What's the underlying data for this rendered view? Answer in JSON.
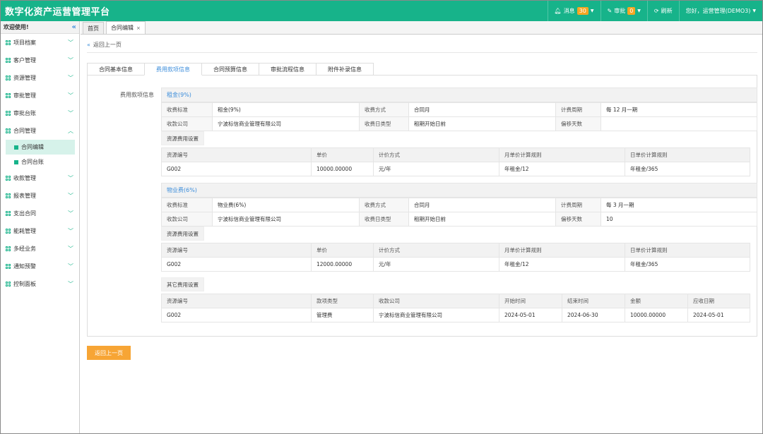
{
  "app": {
    "title": "数字化资产运营管理平台"
  },
  "topbar": {
    "messages_label": "消息",
    "messages_count": "30",
    "approval_label": "审批",
    "approval_count": "0",
    "refresh_label": "刷新",
    "user_label": "您好，运营管理(DEMO3)"
  },
  "sidebar": {
    "welcome": "欢迎使用!",
    "items": [
      {
        "label": "项目档案"
      },
      {
        "label": "客户管理"
      },
      {
        "label": "资源管理"
      },
      {
        "label": "审批管理"
      },
      {
        "label": "审批台账"
      },
      {
        "label": "合同管理"
      },
      {
        "label": "收款管理"
      },
      {
        "label": "报表管理"
      },
      {
        "label": "支出合同"
      },
      {
        "label": "能耗管理"
      },
      {
        "label": "多经业务"
      },
      {
        "label": "通知预警"
      },
      {
        "label": "控制面板"
      }
    ],
    "sub_items": [
      {
        "label": "合同编辑"
      },
      {
        "label": "合同台账"
      }
    ]
  },
  "page_tabs": [
    {
      "label": "首页"
    },
    {
      "label": "合同编辑"
    }
  ],
  "back_link": "返回上一页",
  "content_tabs": [
    {
      "label": "合同基本信息"
    },
    {
      "label": "费用款项信息"
    },
    {
      "label": "合同预算信息"
    },
    {
      "label": "审批流程信息"
    },
    {
      "label": "附件补录信息"
    }
  ],
  "panel_label": "费用款项信息",
  "fee1": {
    "title": "租金(9%)",
    "row1": [
      "收费标准",
      "租金(9%)",
      "收费方式",
      "合同月",
      "计费周期",
      "每 12 月一期"
    ],
    "row2": [
      "收款公司",
      "宁波标信商业管理有限公司",
      "收费日类型",
      "租期开始日前",
      "偏移天数",
      ""
    ],
    "resource_label": "资源费用设置",
    "headers": [
      "资源编号",
      "单价",
      "计价方式",
      "月单价计算规则",
      "日单价计算规则"
    ],
    "row": [
      "G002",
      "10000.00000",
      "元/年",
      "年租金/12",
      "年租金/365"
    ]
  },
  "fee2": {
    "title": "物业费(6%)",
    "row1": [
      "收费标准",
      "物业费(6%)",
      "收费方式",
      "合同月",
      "计费周期",
      "每 3 月一期"
    ],
    "row2": [
      "收款公司",
      "宁波标信商业管理有限公司",
      "收费日类型",
      "租期开始日前",
      "偏移天数",
      "10"
    ],
    "resource_label": "资源费用设置",
    "headers": [
      "资源编号",
      "单价",
      "计价方式",
      "月单价计算规则",
      "日单价计算规则"
    ],
    "row": [
      "G002",
      "12000.00000",
      "元/年",
      "年租金/12",
      "年租金/365"
    ]
  },
  "other": {
    "label": "其它费用设置",
    "headers": [
      "资源编号",
      "款项类型",
      "收款公司",
      "开始时间",
      "结束时间",
      "金额",
      "应收日期"
    ],
    "row": [
      "G002",
      "管理费",
      "宁波标信商业管理有限公司",
      "2024-05-01",
      "2024-06-30",
      "10000.00000",
      "2024-05-01"
    ]
  },
  "bottom_button": "返回上一页"
}
